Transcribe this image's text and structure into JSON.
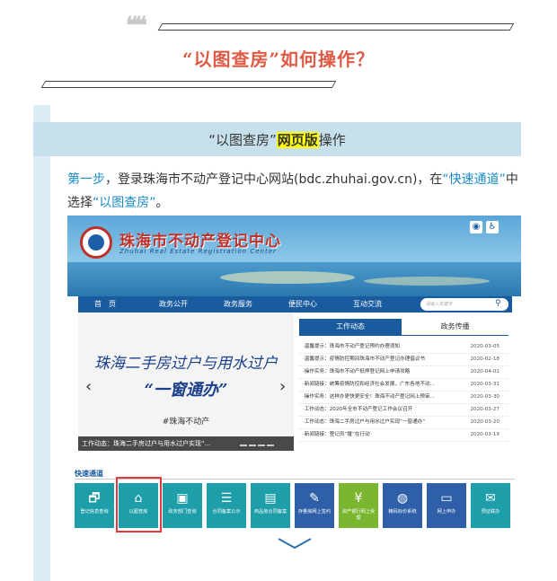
{
  "header": {
    "quote_mark": "❝❝",
    "title": "“以图查房”如何操作？"
  },
  "section": {
    "title_pre": "“以图查房”",
    "title_highlight": "网页版",
    "title_post": "操作"
  },
  "step": {
    "p1": "第一步",
    "p2": "，登录珠海市不动产登记中心网站(bdc.zhuhai.gov.cn)，在",
    "p3": "“快速通道”",
    "p4": "中选择",
    "p5": "“以图查房”",
    "p6": "。"
  },
  "site": {
    "name": "珠海市不动产登记中心",
    "name_en": "Zhuhai Real Estate Registration Center",
    "logo_text": "",
    "util_icons": [
      "weibo-icon",
      "accessibility-icon"
    ],
    "nav": [
      "首　页",
      "政务公开",
      "政务服务",
      "便民中心",
      "互动交流"
    ],
    "search_placeholder": "请输入关键字",
    "slide": {
      "line1": "珠海二手房过户与用水过户",
      "line2": "“一窗通办”",
      "tag": "#珠海不动产",
      "caption": "工作动态：珠海二手房过户与用水过户实现“..."
    },
    "tabs": [
      "工作动态",
      "政务传播"
    ],
    "news": [
      {
        "title": "·温馨提示：珠海市不动产登记预约办理须知",
        "date": "2020-03-05"
      },
      {
        "title": "·温馨提示：疫情防控期间珠海市不动产登记办理倡议书",
        "date": "2020-02-18"
      },
      {
        "title": "·操作实务：珠海市不动产抵押登记网上申请攻略",
        "date": "2020-04-01"
      },
      {
        "title": "·新闻链接：统筹疫情防控和经济社会发展，广东各地不动...",
        "date": "2020-03-31"
      },
      {
        "title": "·操作实务：这样办更快更安全！珠海不动产登记网上预审...",
        "date": "2020-03-30"
      },
      {
        "title": "·工作动态：2020年全市不动产登记工作会议召开",
        "date": "2020-03-27"
      },
      {
        "title": "·工作动态：珠海二手房过户与用水过户实现“一窗通办”",
        "date": "2020-03-20"
      },
      {
        "title": "·新闻链接：登记员“援”在行动",
        "date": "2020-03-19"
      }
    ],
    "quick_label": "快速通道",
    "quick": [
      {
        "label": "登记信息查询",
        "icon": "document-search-icon",
        "color": "#1e9ea8"
      },
      {
        "label": "以图查房",
        "icon": "house-search-icon",
        "color": "#1e9ea8"
      },
      {
        "label": "政务部门查询",
        "icon": "id-card-icon",
        "color": "#1e9ea8"
      },
      {
        "label": "合同备案公示",
        "icon": "file-list-icon",
        "color": "#1e9ea8"
      },
      {
        "label": "商品房合同备案",
        "icon": "clipboard-icon",
        "color": "#1e9ea8"
      },
      {
        "label": "存量房网上签约",
        "icon": "pen-sign-icon",
        "color": "#2e5fa8"
      },
      {
        "label": "资产银行网上受理",
        "icon": "money-icon",
        "color": "#7ab630"
      },
      {
        "label": "精码标价系统",
        "icon": "mouse-icon",
        "color": "#2e5fa8"
      },
      {
        "label": "网上申办",
        "icon": "monitor-icon",
        "color": "#2e5fa8"
      },
      {
        "label": "预证联办",
        "icon": "stamp-icon",
        "color": "#1e9ea8"
      }
    ]
  }
}
